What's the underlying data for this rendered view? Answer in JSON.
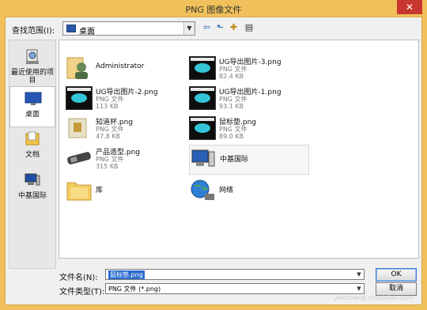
{
  "window": {
    "title": "PNG 图像文件",
    "close_glyph": "✕"
  },
  "lookin": {
    "label": "查找范围(I):",
    "value": "桌面"
  },
  "toolbar": {
    "back_glyph": "⇦",
    "up_glyph": "⬑",
    "newfolder_glyph": "✚",
    "view_glyph": "▤"
  },
  "places": [
    {
      "label": "最近使用的项目",
      "icon": "recent-items-icon"
    },
    {
      "label": "桌面",
      "icon": "desktop-icon"
    },
    {
      "label": "文档",
      "icon": "documents-icon"
    },
    {
      "label": "中基国际",
      "icon": "computer-icon"
    }
  ],
  "files": [
    {
      "name": "Administrator",
      "type": "",
      "size": "",
      "icon": "user-folder-icon"
    },
    {
      "name": "UG导出图片-3.png",
      "type": "PNG 文件",
      "size": "82.4 KB",
      "icon": "png-thumbnail-icon"
    },
    {
      "name": "UG导出图片-2.png",
      "type": "PNG 文件",
      "size": "113 KB",
      "icon": "png-thumbnail-icon"
    },
    {
      "name": "UG导出图片-1.png",
      "type": "PNG 文件",
      "size": "93.1 KB",
      "icon": "png-thumbnail-icon"
    },
    {
      "name": "知道杯.png",
      "type": "PNG 文件",
      "size": "47.8 KB",
      "icon": "png-thumbnail-icon"
    },
    {
      "name": "鼠标垫.png",
      "type": "PNG 文件",
      "size": "89.0 KB",
      "icon": "png-thumbnail-icon"
    },
    {
      "name": "产品造型.png",
      "type": "PNG 文件",
      "size": "315 KB",
      "icon": "png-thumbnail-icon"
    },
    {
      "name": "中基国际",
      "type": "",
      "size": "",
      "icon": "computer-icon"
    },
    {
      "name": "库",
      "type": "",
      "size": "",
      "icon": "libraries-folder-icon"
    },
    {
      "name": "网络",
      "type": "",
      "size": "",
      "icon": "network-globe-icon"
    }
  ],
  "filename": {
    "label": "文件名(N):",
    "value": "鼠标垫.png"
  },
  "filetype": {
    "label": "文件类型(T):",
    "value": "PNG 文件 (*.png)"
  },
  "buttons": {
    "ok": "OK",
    "cancel": "取消"
  },
  "watermark": "jiaocheng.chazidian.com"
}
